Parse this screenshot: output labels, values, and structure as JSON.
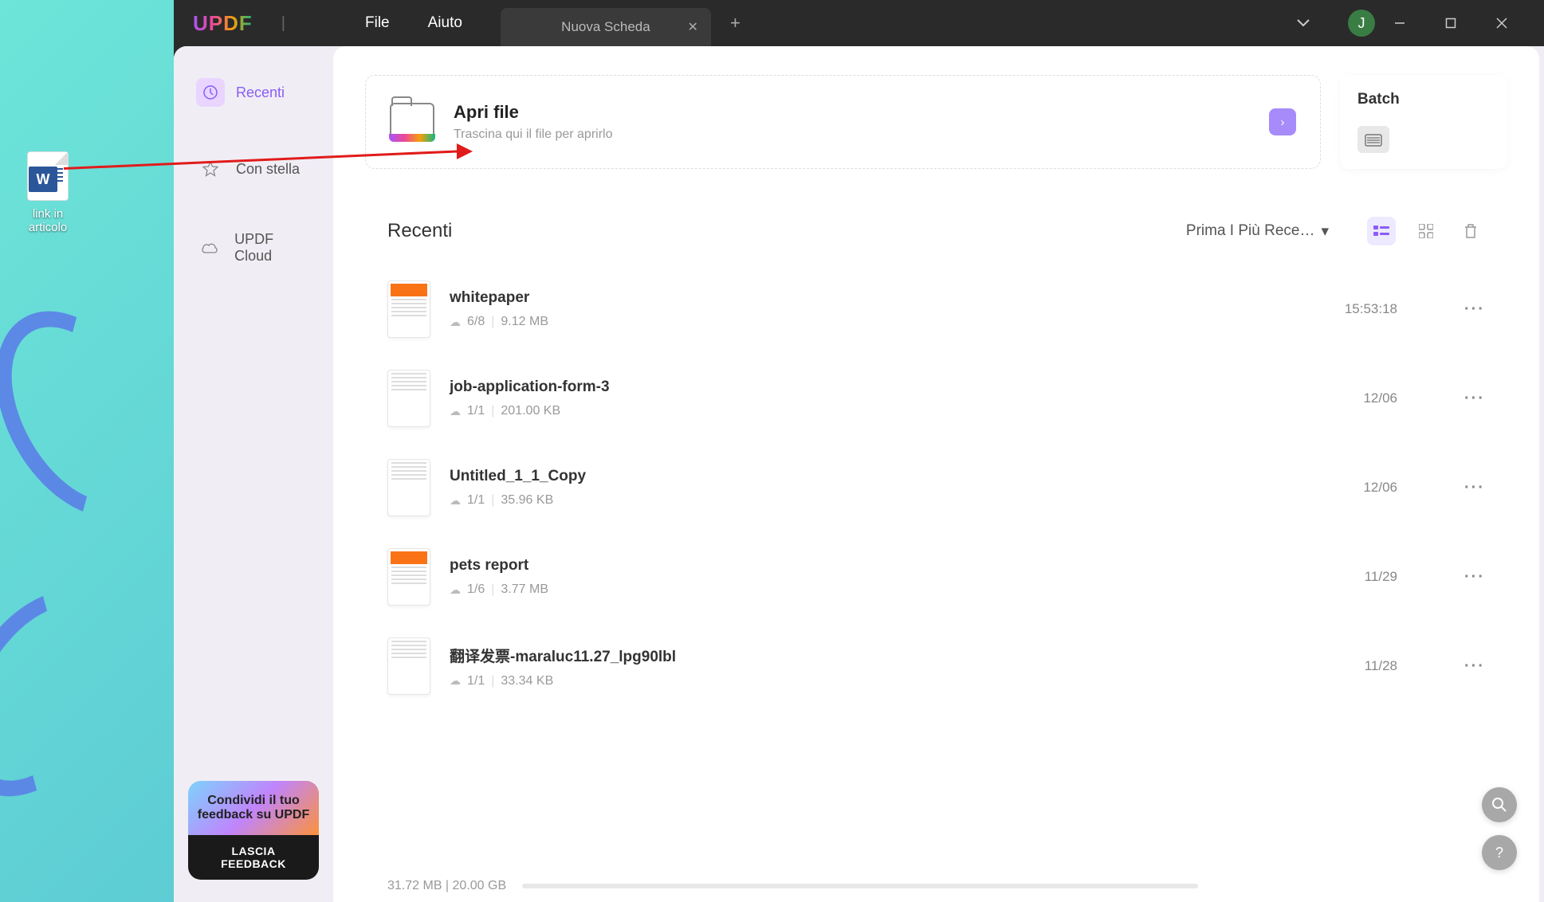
{
  "desktop": {
    "file_label": "link in articolo",
    "word_letter": "W"
  },
  "title_bar": {
    "logo": "UPDF",
    "menu_file": "File",
    "menu_help": "Aiuto",
    "tab_label": "Nuova Scheda",
    "avatar_letter": "J"
  },
  "sidebar": {
    "recent": "Recenti",
    "starred": "Con stella",
    "cloud": "UPDF Cloud"
  },
  "feedback": {
    "promo_text": "Condividi il tuo feedback su UPDF",
    "button": "LASCIA FEEDBACK"
  },
  "open_file": {
    "title": "Apri file",
    "subtitle": "Trascina qui il file per aprirlo"
  },
  "batch": {
    "title": "Batch"
  },
  "recent": {
    "title": "Recenti",
    "sort": "Prima I Più Rece…"
  },
  "files": [
    {
      "name": "whitepaper",
      "pages": "6/8",
      "size": "9.12 MB",
      "date": "15:53:18"
    },
    {
      "name": "job-application-form-3",
      "pages": "1/1",
      "size": "201.00 KB",
      "date": "12/06"
    },
    {
      "name": "Untitled_1_1_Copy",
      "pages": "1/1",
      "size": "35.96 KB",
      "date": "12/06"
    },
    {
      "name": "pets report",
      "pages": "1/6",
      "size": "3.77 MB",
      "date": "11/29"
    },
    {
      "name": "翻译发票-maraluc11.27_lpg90lbl",
      "pages": "1/1",
      "size": "33.34 KB",
      "date": "11/28"
    }
  ],
  "status": {
    "storage": "31.72 MB | 20.00 GB"
  }
}
